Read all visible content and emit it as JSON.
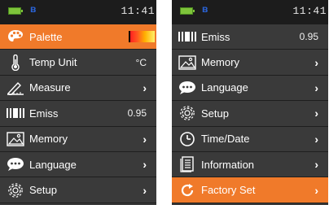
{
  "left": {
    "clock": "11:41",
    "bluetooth": "ʙ",
    "items": [
      {
        "label": "Palette",
        "value": "",
        "icon": "palette-icon"
      },
      {
        "label": "Temp Unit",
        "value": "°C",
        "icon": "thermometer-icon"
      },
      {
        "label": "Measure",
        "value": "",
        "chevron": "›",
        "icon": "measure-icon"
      },
      {
        "label": "Emiss",
        "value": "0.95",
        "icon": "emissivity-icon"
      },
      {
        "label": "Memory",
        "value": "",
        "chevron": "›",
        "icon": "image-icon"
      },
      {
        "label": "Language",
        "value": "",
        "chevron": "›",
        "icon": "speech-bubble-icon"
      },
      {
        "label": "Setup",
        "value": "",
        "chevron": "›",
        "icon": "gear-icon"
      }
    ]
  },
  "right": {
    "clock": "11:41",
    "bluetooth": "ʙ",
    "items": [
      {
        "label": "Emiss",
        "value": "0.95",
        "icon": "emissivity-icon"
      },
      {
        "label": "Memory",
        "value": "",
        "chevron": "›",
        "icon": "image-icon"
      },
      {
        "label": "Language",
        "value": "",
        "chevron": "›",
        "icon": "speech-bubble-icon"
      },
      {
        "label": "Setup",
        "value": "",
        "chevron": "›",
        "icon": "gear-icon"
      },
      {
        "label": "Time/Date",
        "value": "",
        "chevron": "›",
        "icon": "clock-icon"
      },
      {
        "label": "Information",
        "value": "",
        "chevron": "›",
        "icon": "document-icon"
      },
      {
        "label": "Factory Set",
        "value": "",
        "chevron": "›",
        "icon": "reset-icon"
      }
    ]
  },
  "colors": {
    "accent": "#f07a2a",
    "background": "#3a3a3a",
    "status_bar": "#1c1c1c",
    "battery": "#7ec43b"
  }
}
